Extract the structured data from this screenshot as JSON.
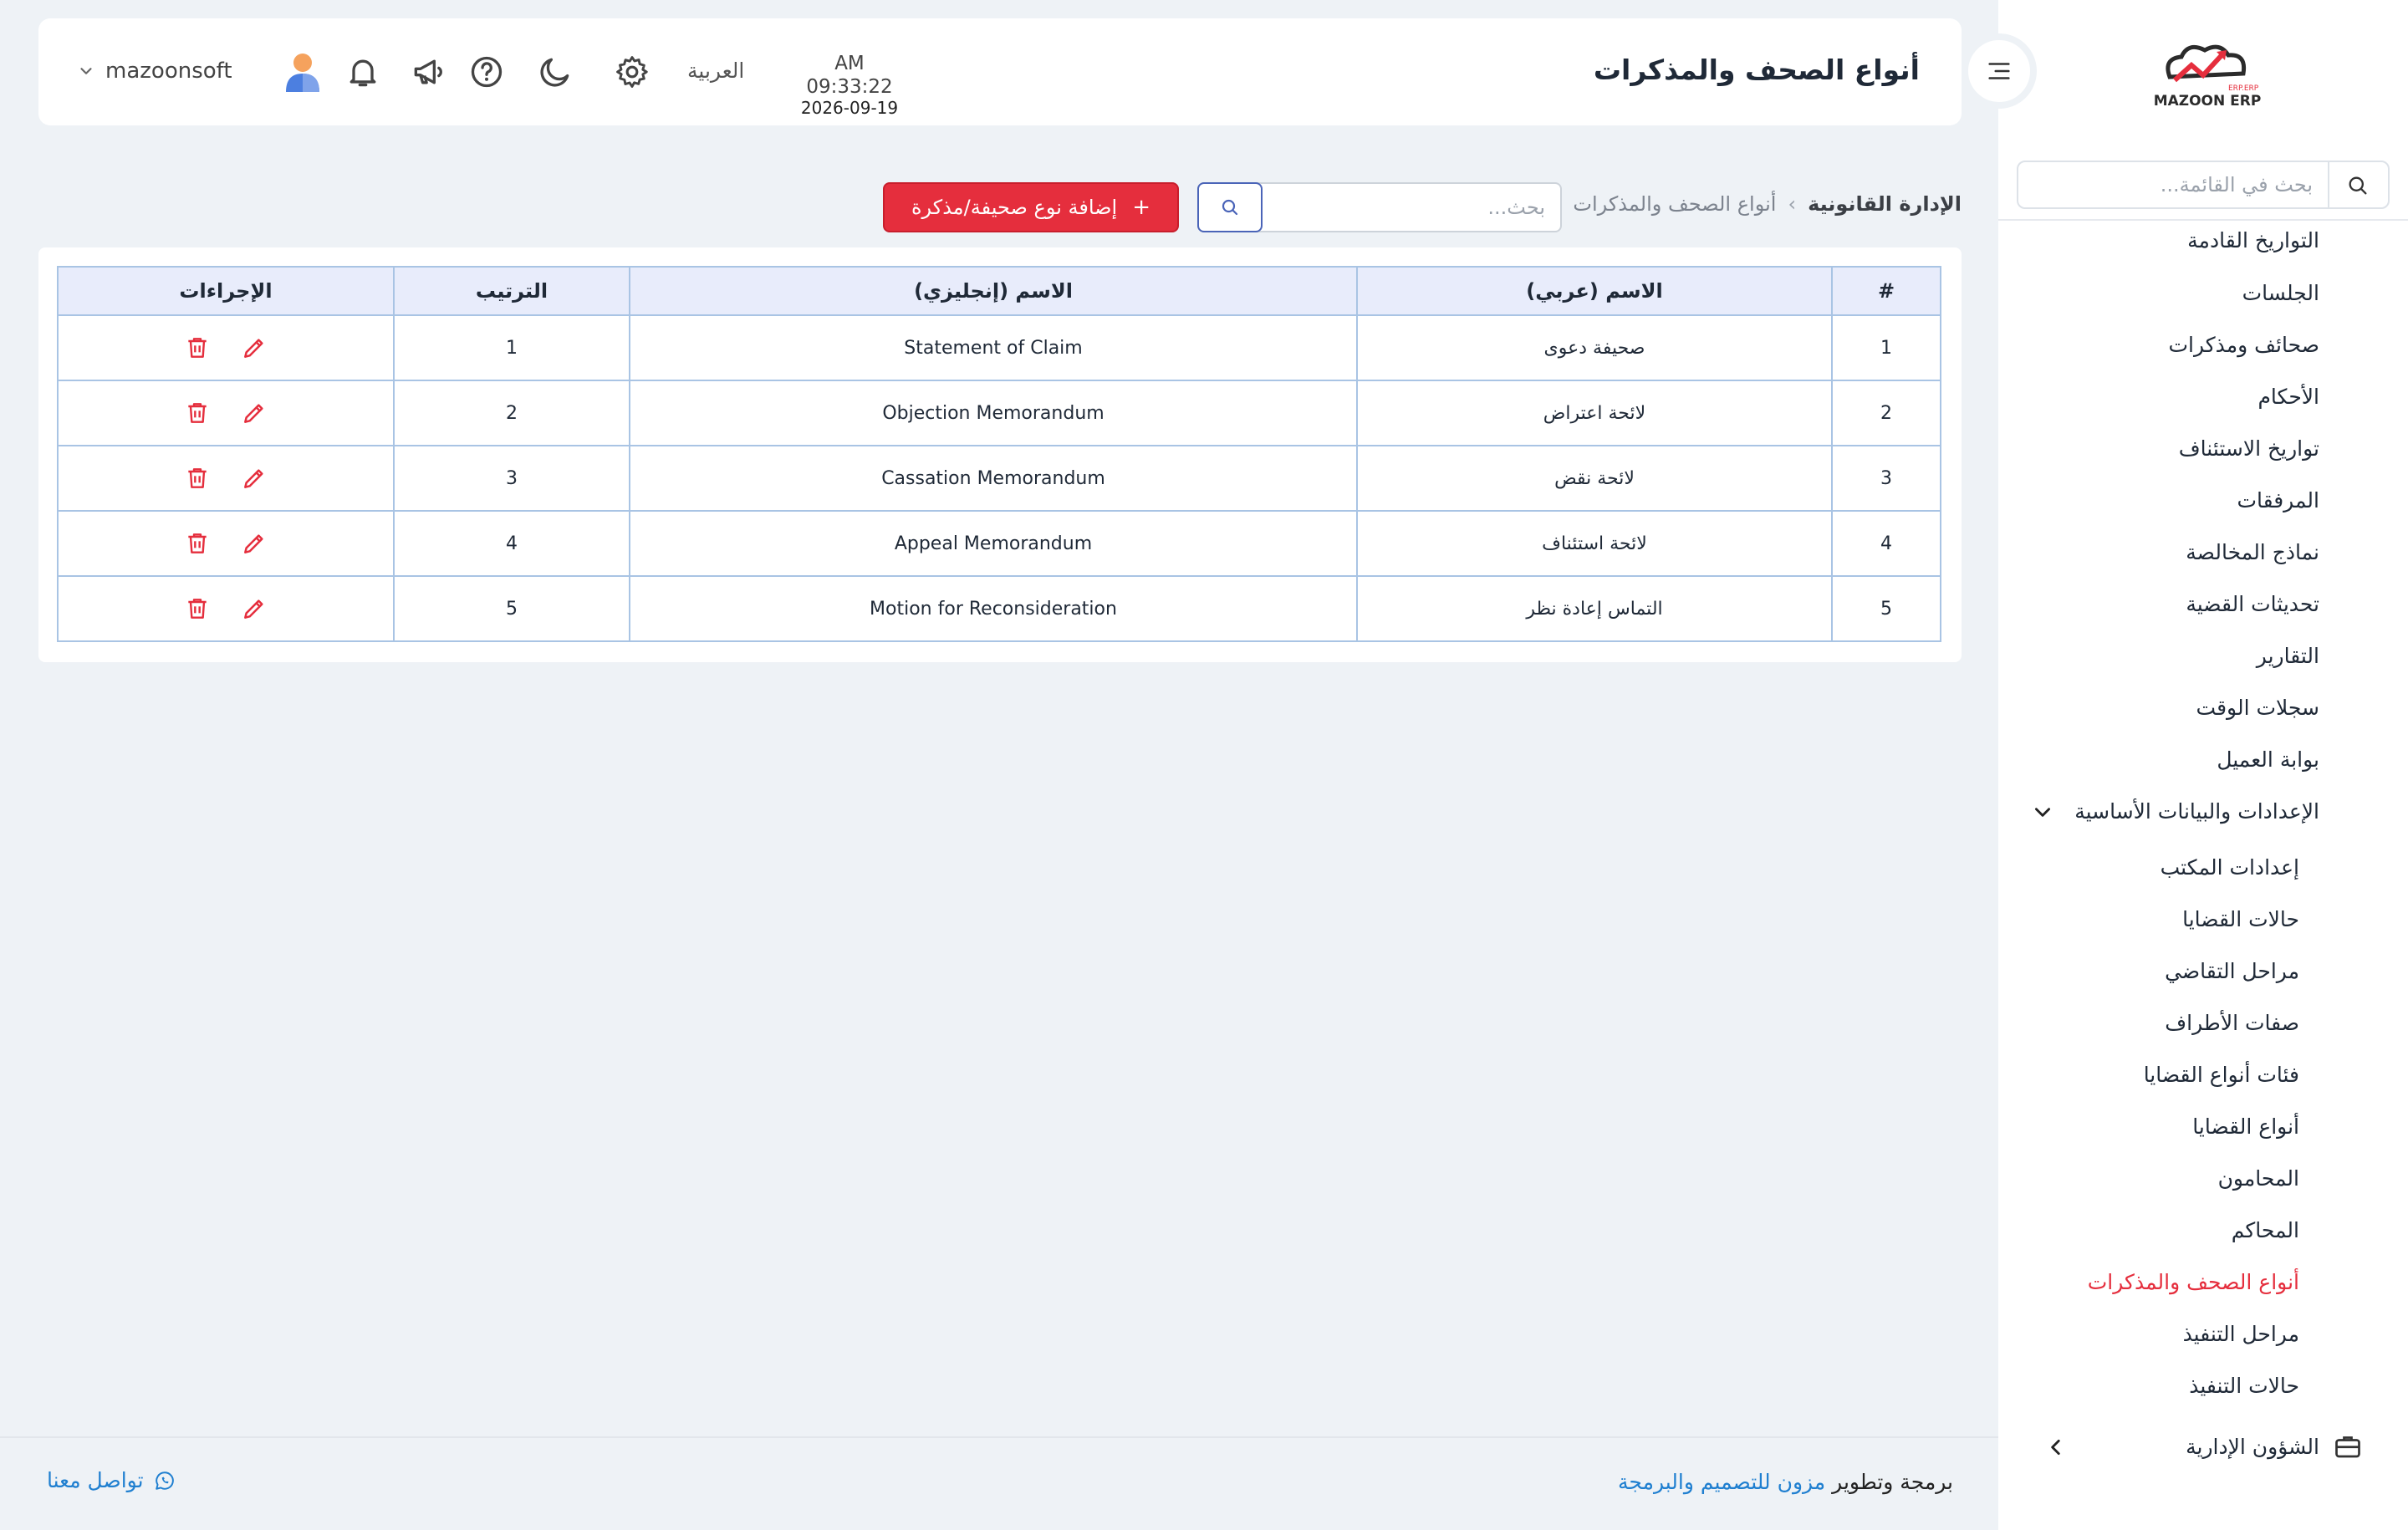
{
  "header": {
    "page_title": "أنواع الصحف والمذكرات",
    "time": "AM 09:33:22",
    "date": "2026-09-19",
    "language": "العربية",
    "username": "mazoonsoft"
  },
  "logo": {
    "text": "MAZOON ERP",
    "tagline": "ERP.ERP"
  },
  "sidebar": {
    "search_placeholder": "بحث في القائمة...",
    "items": [
      "التواريخ القادمة",
      "الجلسات",
      "صحائف ومذكرات",
      "الأحكام",
      "تواريخ الاستئناف",
      "المرفقات",
      "نماذج المخالصة",
      "تحديثات القضية",
      "التقارير",
      "سجلات الوقت",
      "بوابة العميل",
      "الإعدادات والبيانات الأساسية"
    ],
    "sub_items": [
      "إعدادات المكتب",
      "حالات القضايا",
      "مراحل التقاضي",
      "صفات الأطراف",
      "فئات أنواع القضايا",
      "أنواع القضايا",
      "المحامون",
      "المحاكم",
      "أنواع الصحف والمذكرات",
      "مراحل التنفيذ",
      "حالات التنفيذ"
    ],
    "active_sub_item": "أنواع الصحف والمذكرات",
    "admin_item": "الشؤون الإدارية"
  },
  "breadcrumb": {
    "root": "الإدارة القانونية",
    "separator": "›",
    "current": "أنواع الصحف والمذكرات"
  },
  "toolbar": {
    "search_placeholder": "بحث...",
    "add_label": "إضافة نوع صحيفة/مذكرة",
    "add_icon": "+"
  },
  "table": {
    "headers": [
      "#",
      "الاسم (عربي)",
      "الاسم (إنجليزي)",
      "الترتيب",
      "الإجراءات"
    ],
    "rows": [
      {
        "num": "1",
        "name_ar": "صحيفة دعوى",
        "name_en": "Statement of Claim",
        "order": "1"
      },
      {
        "num": "2",
        "name_ar": "لائحة اعتراض",
        "name_en": "Objection Memorandum",
        "order": "2"
      },
      {
        "num": "3",
        "name_ar": "لائحة نقض",
        "name_en": "Cassation Memorandum",
        "order": "3"
      },
      {
        "num": "4",
        "name_ar": "لائحة استئناف",
        "name_en": "Appeal Memorandum",
        "order": "4"
      },
      {
        "num": "5",
        "name_ar": "التماس إعادة نظر",
        "name_en": "Motion for Reconsideration",
        "order": "5"
      }
    ]
  },
  "footer": {
    "credit_prefix": "برمجة وتطوير",
    "company": "مزون للتصميم والبرمجة",
    "contact": "تواصل معنا"
  },
  "colors": {
    "accent": "#e52e3d",
    "link": "#1f7fd0",
    "table_border": "#a9c4e4",
    "table_header_bg": "#e8ecfb",
    "page_bg": "#eef2f6"
  }
}
